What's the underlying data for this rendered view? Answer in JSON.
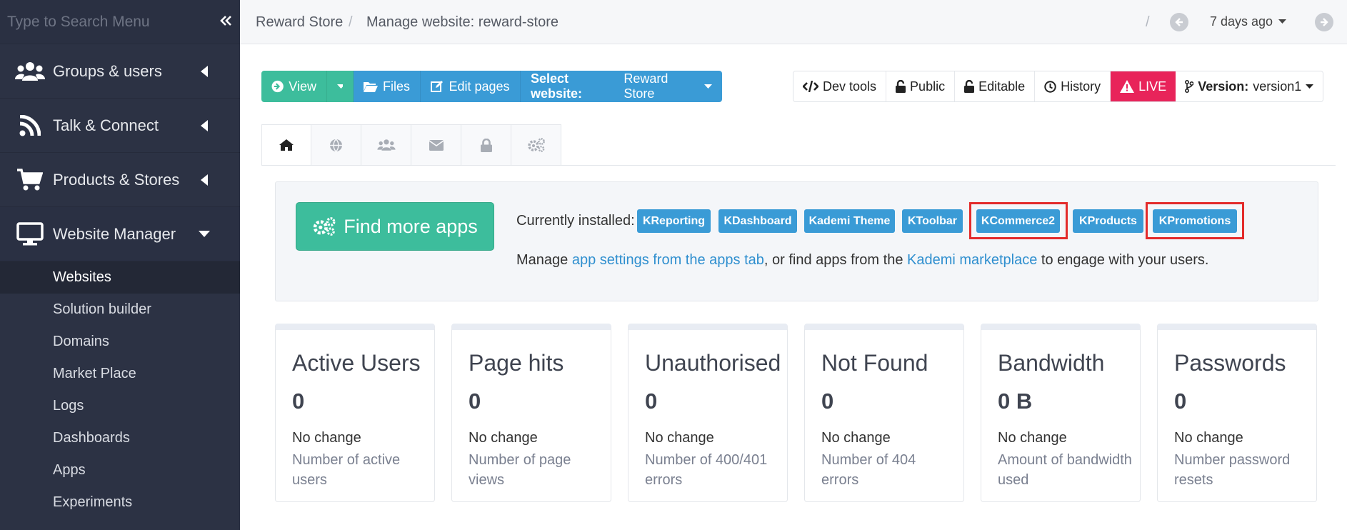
{
  "sidebar": {
    "search_placeholder": "Type to Search Menu",
    "groups": [
      {
        "label": "Groups & users",
        "icon": "users-icon"
      },
      {
        "label": "Talk & Connect",
        "icon": "rss-icon"
      },
      {
        "label": "Products & Stores",
        "icon": "cart-icon"
      },
      {
        "label": "Website Manager",
        "icon": "monitor-icon"
      }
    ],
    "sub_items": [
      "Websites",
      "Solution builder",
      "Domains",
      "Market Place",
      "Logs",
      "Dashboards",
      "Apps",
      "Experiments"
    ],
    "selected_sub": "Websites"
  },
  "topbar": {
    "crumb1": "Reward Store",
    "crumb2": "Manage website: reward-store",
    "separator": "/",
    "time_range": "7 days ago"
  },
  "toolbar": {
    "view": "View",
    "files": "Files",
    "edit_pages": "Edit pages",
    "select_website_label": "Select website:",
    "select_website_value": "Reward Store",
    "dev_tools": "Dev tools",
    "public": "Public",
    "editable": "Editable",
    "history": "History",
    "live": "LIVE",
    "version_label": "Version:",
    "version_value": "version1"
  },
  "tabs": [
    "home-icon",
    "globe-icon",
    "users-icon",
    "envelope-icon",
    "lock-icon",
    "cogs-icon"
  ],
  "apps": {
    "find_button": "Find more apps",
    "installed_label": "Currently installed:",
    "badges": [
      "KReporting",
      "KDashboard",
      "Kademi Theme",
      "KToolbar",
      "KCommerce2",
      "KProducts",
      "KPromotions"
    ],
    "highlighted": [
      "KCommerce2",
      "KPromotions"
    ],
    "manage_prefix": "Manage ",
    "manage_link1": "app settings from the apps tab",
    "manage_mid": ", or find apps from the ",
    "manage_link2": "Kademi marketplace",
    "manage_suffix": " to engage with your users."
  },
  "stats": [
    {
      "title": "Active Users",
      "value": "0",
      "change": "No change",
      "desc": "Number of active users"
    },
    {
      "title": "Page hits",
      "value": "0",
      "change": "No change",
      "desc": "Number of page views"
    },
    {
      "title": "Unauthorised",
      "value": "0",
      "change": "No change",
      "desc": "Number of 400/401 errors"
    },
    {
      "title": "Not Found",
      "value": "0",
      "change": "No change",
      "desc": "Number of 404 errors"
    },
    {
      "title": "Bandwidth",
      "value": "0 B",
      "change": "No change",
      "desc": "Amount of bandwidth used"
    },
    {
      "title": "Passwords",
      "value": "0",
      "change": "No change",
      "desc": "Number password resets"
    }
  ]
}
